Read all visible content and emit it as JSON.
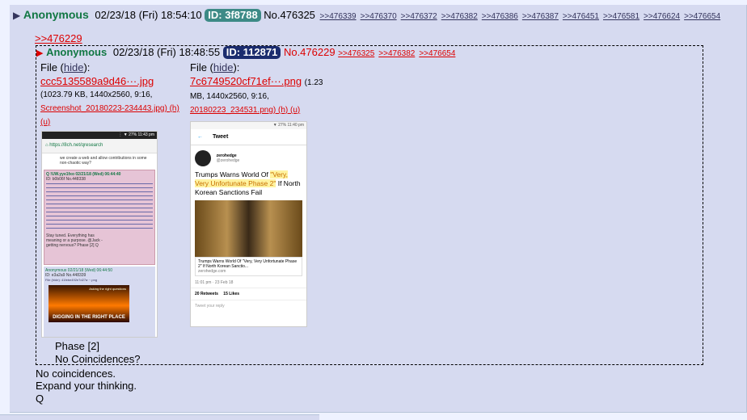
{
  "post": {
    "name": "Anonymous",
    "date": "02/23/18 (Fri) 18:54:10",
    "id": "ID: 3f8788",
    "id_color": "#3d8a86",
    "number": "No.476325",
    "backlinks": [
      ">>476339",
      ">>476370",
      ">>476372",
      ">>476382",
      ">>476386",
      ">>476387",
      ">>476451",
      ">>476581",
      ">>476624",
      ">>476654"
    ],
    "quote_link": ">>476229",
    "body_lines": [
      "No coincidences.",
      "Expand your thinking.",
      "Q"
    ]
  },
  "inline_post": {
    "name": "Anonymous",
    "date": "02/23/18 (Fri) 18:48:55",
    "id": "ID: 112871",
    "id_color": "#1b2c6e",
    "number": "No.476229",
    "backlinks": [
      ">>476325",
      ">>476382",
      ">>476654"
    ],
    "files": [
      {
        "label": "File (",
        "hide": "hide",
        "close": "):",
        "name": "ccc5135589a9d46···.jpg",
        "meta1": "(1023.79 KB, 1440x2560, 9:16,",
        "meta2": "Screenshot_20180223-234443.jpg) (h)",
        "meta3": "(u)"
      },
      {
        "label": "File (",
        "hide": "hide",
        "close": "):",
        "name": "7c6749520cf71ef···.png",
        "meta_inline": "(1.23",
        "meta1": "MB, 1440x2560, 9:16,",
        "meta2": "20180223_234531.png) (h) (u)"
      }
    ],
    "body_lines": [
      "Phase [2]",
      "No Coincidences?"
    ]
  },
  "thumb1": {
    "status": "⋮ ▼ 27% 11:43 pm",
    "url": "https://8ch.net/qresearch",
    "intro": "we create a web and allow contributions in some non-chaotic way?",
    "post1_head": "Q !UW.yye1fxo 02/21/18 (Wed) 06:44:40",
    "post1_id": "ID: b0b06f No.448338",
    "post1_text": "Stay tuned. Everything has meaning or a purpose. @Jack - getting nervous? Phase [2] Q",
    "post2_head": "Anonymous 02/21/18 (Wed) 06:44:50",
    "post2_id": "ID: e3a2a9 No.448339",
    "post2_file": "File (hide): 41febe492e7d27a···.png",
    "caption_top": "Asking the right questions",
    "caption_bottom": "DIGGING IN THE RIGHT PLACE"
  },
  "thumb2": {
    "status": "▼ 27% 11:40 pm",
    "header": "Tweet",
    "handle": "zerohedge",
    "at": "@zerohedge",
    "headline_pre": "Trumps Warns World Of ",
    "headline_hl": "\"Very, Very Unfortunate Phase 2\"",
    "headline_post": " If North Korean Sanctions Fail",
    "card_title": "Trumps Warns World Of \"Very, Very Unfortunate Phase 2\" If North Korean Sanctio...",
    "card_domain": "zerohedge.com",
    "time": "11:01 pm · 23 Feb 18",
    "retweets": "20 Retweets",
    "likes": "15 Likes",
    "reply": "Tweet your reply"
  }
}
